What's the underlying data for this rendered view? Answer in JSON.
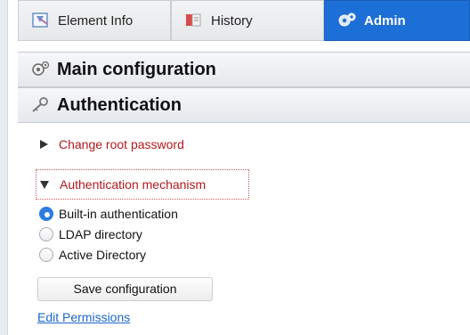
{
  "tabs": [
    {
      "label": "Element Info",
      "icon": "element-info-icon"
    },
    {
      "label": "History",
      "icon": "history-icon"
    },
    {
      "label": "Admin",
      "icon": "admin-icon",
      "active": true
    }
  ],
  "sections": {
    "main_config": {
      "title": "Main configuration",
      "icon": "gears-icon"
    },
    "authentication": {
      "title": "Authentication",
      "icon": "key-icon"
    }
  },
  "links": {
    "change_root_password": "Change root password",
    "authentication_mechanism": "Authentication mechanism"
  },
  "auth_options": [
    {
      "label": "Built-in authentication",
      "checked": true
    },
    {
      "label": "LDAP directory",
      "checked": false
    },
    {
      "label": "Active Directory",
      "checked": false
    }
  ],
  "buttons": {
    "save_configuration": "Save configuration"
  },
  "footer": {
    "edit_permissions": "Edit Permissions"
  },
  "colors": {
    "active_tab": "#1c6fd6",
    "link_red": "#b3191c",
    "link_blue": "#1b66c9",
    "radio_checked": "#2c7be5"
  }
}
